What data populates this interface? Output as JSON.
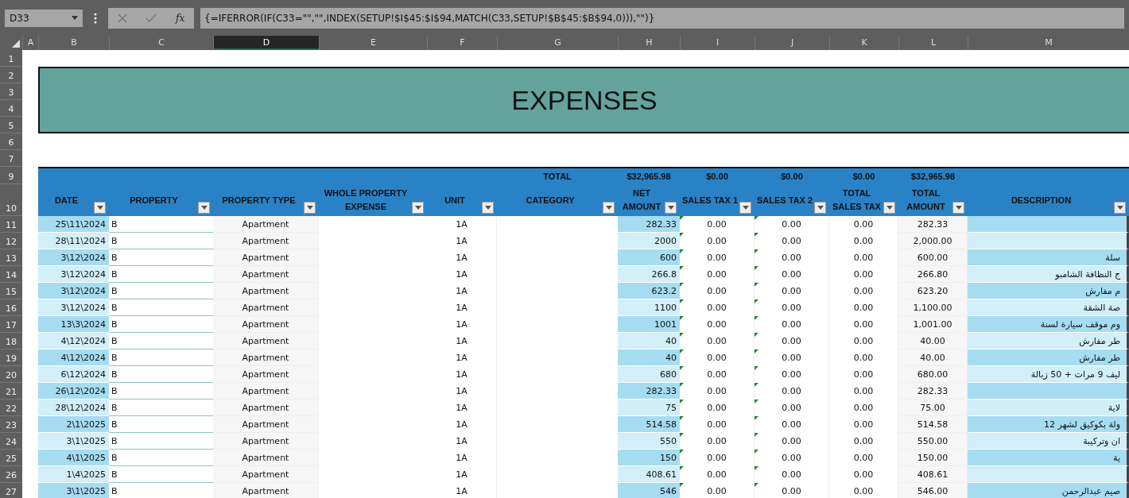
{
  "name_box": "D33",
  "formula_bar": {
    "function_label": "fx",
    "formula": "{=IFERROR(IF(C33=\"\",\"\",INDEX(SETUP!$I$45:$I$94,MATCH(C33,SETUP!$B$45:$B$94,0))),\"\")}"
  },
  "column_headers": [
    {
      "label": "A",
      "selected": false
    },
    {
      "label": "B",
      "selected": false
    },
    {
      "label": "C",
      "selected": false
    },
    {
      "label": "D",
      "selected": true
    },
    {
      "label": "E",
      "selected": false
    },
    {
      "label": "F",
      "selected": false
    },
    {
      "label": "G",
      "selected": false
    },
    {
      "label": "H",
      "selected": false
    },
    {
      "label": "I",
      "selected": false
    },
    {
      "label": "J",
      "selected": false
    },
    {
      "label": "K",
      "selected": false
    },
    {
      "label": "L",
      "selected": false
    },
    {
      "label": "M",
      "selected": false
    }
  ],
  "top_row_numbers": [
    "1",
    "2",
    "3",
    "4",
    "5",
    "6",
    "7",
    "9",
    "10"
  ],
  "title": "EXPENSES",
  "table": {
    "totals_label": "TOTAL",
    "totals": [
      "$32,965.98",
      "$0.00",
      "$0.00",
      "$0.00",
      "$32,965.98"
    ],
    "columns": [
      {
        "label": "DATE"
      },
      {
        "label": "PROPERTY"
      },
      {
        "label": "PROPERTY TYPE"
      },
      {
        "label": "WHOLE PROPERTY EXPENSE"
      },
      {
        "label": "UNIT"
      },
      {
        "label": "CATEGORY"
      },
      {
        "label": "NET AMOUNT"
      },
      {
        "label": "SALES TAX 1"
      },
      {
        "label": "SALES TAX 2"
      },
      {
        "label": "TOTAL SALES TAX"
      },
      {
        "label": "TOTAL AMOUNT"
      },
      {
        "label": "DESCRIPTION"
      }
    ],
    "rows": [
      {
        "row_number": "11",
        "date": "25\\11\\2024",
        "property": "B",
        "property_type": "Apartment",
        "unit": "1A",
        "net_amount": "282.33",
        "sales_tax_1": "0.00",
        "sales_tax_2": "0.00",
        "total_sales_tax": "0.00",
        "total_amount": "282.33"
      },
      {
        "row_number": "12",
        "date": "28\\11\\2024",
        "property": "B",
        "property_type": "Apartment",
        "unit": "1A",
        "net_amount": "2000",
        "sales_tax_1": "0.00",
        "sales_tax_2": "0.00",
        "total_sales_tax": "0.00",
        "total_amount": "2,000.00"
      },
      {
        "row_number": "13",
        "date": "3\\12\\2024",
        "property": "B",
        "property_type": "Apartment",
        "unit": "1A",
        "net_amount": "600",
        "sales_tax_1": "0.00",
        "sales_tax_2": "0.00",
        "total_sales_tax": "0.00",
        "total_amount": "600.00",
        "description": "سلة"
      },
      {
        "row_number": "14",
        "date": "3\\12\\2024",
        "property": "B",
        "property_type": "Apartment",
        "unit": "1A",
        "net_amount": "266.8",
        "sales_tax_1": "0.00",
        "sales_tax_2": "0.00",
        "total_sales_tax": "0.00",
        "total_amount": "266.80",
        "description": "ج النظافة الشامبو"
      },
      {
        "row_number": "15",
        "date": "3\\12\\2024",
        "property": "B",
        "property_type": "Apartment",
        "unit": "1A",
        "net_amount": "623.2",
        "sales_tax_1": "0.00",
        "sales_tax_2": "0.00",
        "total_sales_tax": "0.00",
        "total_amount": "623.20",
        "description": "م مفارش"
      },
      {
        "row_number": "16",
        "date": "3\\12\\2024",
        "property": "B",
        "property_type": "Apartment",
        "unit": "1A",
        "net_amount": "1100",
        "sales_tax_1": "0.00",
        "sales_tax_2": "0.00",
        "total_sales_tax": "0.00",
        "total_amount": "1,100.00",
        "description": "صة الشقة"
      },
      {
        "row_number": "17",
        "date": "13\\3\\2024",
        "property": "B",
        "property_type": "Apartment",
        "unit": "1A",
        "net_amount": "1001",
        "sales_tax_1": "0.00",
        "sales_tax_2": "0.00",
        "total_sales_tax": "0.00",
        "total_amount": "1,001.00",
        "description": "وم موقف سيارة لسنة"
      },
      {
        "row_number": "18",
        "date": "4\\12\\2024",
        "property": "B",
        "property_type": "Apartment",
        "unit": "1A",
        "net_amount": "40",
        "sales_tax_1": "0.00",
        "sales_tax_2": "0.00",
        "total_sales_tax": "0.00",
        "total_amount": "40.00",
        "description": "طر مفارش"
      },
      {
        "row_number": "19",
        "date": "4\\12\\2024",
        "property": "B",
        "property_type": "Apartment",
        "unit": "1A",
        "net_amount": "40",
        "sales_tax_1": "0.00",
        "sales_tax_2": "0.00",
        "total_sales_tax": "0.00",
        "total_amount": "40.00",
        "description": "طر مفارش"
      },
      {
        "row_number": "20",
        "date": "6\\12\\2024",
        "property": "B",
        "property_type": "Apartment",
        "unit": "1A",
        "net_amount": "680",
        "sales_tax_1": "0.00",
        "sales_tax_2": "0.00",
        "total_sales_tax": "0.00",
        "total_amount": "680.00",
        "description": "ليف 9 مرات + 50 زبالة"
      },
      {
        "row_number": "21",
        "date": "26\\12\\2024",
        "property": "B",
        "property_type": "Apartment",
        "unit": "1A",
        "net_amount": "282.33",
        "sales_tax_1": "0.00",
        "sales_tax_2": "0.00",
        "total_sales_tax": "0.00",
        "total_amount": "282.33"
      },
      {
        "row_number": "22",
        "date": "28\\12\\2024",
        "property": "B",
        "property_type": "Apartment",
        "unit": "1A",
        "net_amount": "75",
        "sales_tax_1": "0.00",
        "sales_tax_2": "0.00",
        "total_sales_tax": "0.00",
        "total_amount": "75.00",
        "description": "لاية"
      },
      {
        "row_number": "23",
        "date": "2\\1\\2025",
        "property": "B",
        "property_type": "Apartment",
        "unit": "1A",
        "net_amount": "514.58",
        "sales_tax_1": "0.00",
        "sales_tax_2": "0.00",
        "total_sales_tax": "0.00",
        "total_amount": "514.58",
        "description": "ولة بكوكيق لشهر 12"
      },
      {
        "row_number": "24",
        "date": "3\\1\\2025",
        "property": "B",
        "property_type": "Apartment",
        "unit": "1A",
        "net_amount": "550",
        "sales_tax_1": "0.00",
        "sales_tax_2": "0.00",
        "total_sales_tax": "0.00",
        "total_amount": "550.00",
        "description": "ان وتركيبة"
      },
      {
        "row_number": "25",
        "date": "4\\1\\2025",
        "property": "B",
        "property_type": "Apartment",
        "unit": "1A",
        "net_amount": "150",
        "sales_tax_1": "0.00",
        "sales_tax_2": "0.00",
        "total_sales_tax": "0.00",
        "total_amount": "150.00",
        "description": "ية"
      },
      {
        "row_number": "26",
        "date": "1\\4\\2025",
        "property": "B",
        "property_type": "Apartment",
        "unit": "1A",
        "net_amount": "408.61",
        "sales_tax_1": "0.00",
        "sales_tax_2": "0.00",
        "total_sales_tax": "0.00",
        "total_amount": "408.61"
      },
      {
        "row_number": "27",
        "date": "3\\1\\2025",
        "property": "B",
        "property_type": "Apartment",
        "unit": "1A",
        "net_amount": "546",
        "sales_tax_1": "0.00",
        "sales_tax_2": "0.00",
        "total_sales_tax": "0.00",
        "total_amount": "546.00",
        "description": "صيم عبدالرحمن"
      }
    ]
  }
}
